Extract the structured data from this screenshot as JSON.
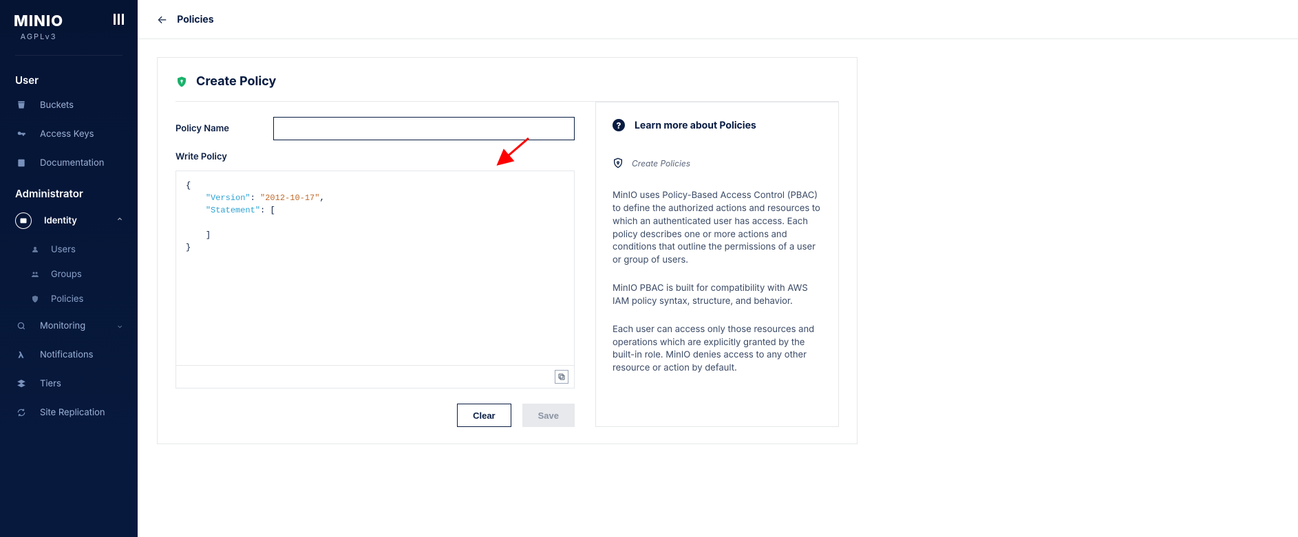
{
  "brand": {
    "logo": "MINIO",
    "sub": "AGPLv3"
  },
  "sidebar": {
    "sectionUser": "User",
    "sectionAdmin": "Administrator",
    "items": {
      "buckets": "Buckets",
      "accessKeys": "Access Keys",
      "documentation": "Documentation",
      "identity": "Identity",
      "users": "Users",
      "groups": "Groups",
      "policies": "Policies",
      "monitoring": "Monitoring",
      "notifications": "Notifications",
      "tiers": "Tiers",
      "siteReplication": "Site Replication"
    }
  },
  "topbar": {
    "title": "Policies"
  },
  "card": {
    "title": "Create Policy",
    "labels": {
      "policyName": "Policy Name",
      "writePolicy": "Write Policy"
    },
    "policyNameValue": "",
    "policyJson": {
      "line1": "{",
      "keyVersion": "\"Version\"",
      "valVersion": "\"2012-10-17\"",
      "keyStatement": "\"Statement\"",
      "bracketOpen": "[",
      "bracketClose": "]",
      "lineEnd": "}"
    },
    "buttons": {
      "clear": "Clear",
      "save": "Save"
    }
  },
  "info": {
    "title": "Learn more about Policies",
    "link": "Create Policies",
    "p1": "MinIO uses Policy-Based Access Control (PBAC) to define the authorized actions and resources to which an authenticated user has access. Each policy describes one or more actions and conditions that outline the permissions of a user or group of users.",
    "p2": "MinIO PBAC is built for compatibility with AWS IAM policy syntax, structure, and behavior.",
    "p3": "Each user can access only those resources and operations which are explicitly granted by the built-in role. MinIO denies access to any other resource or action by default."
  }
}
